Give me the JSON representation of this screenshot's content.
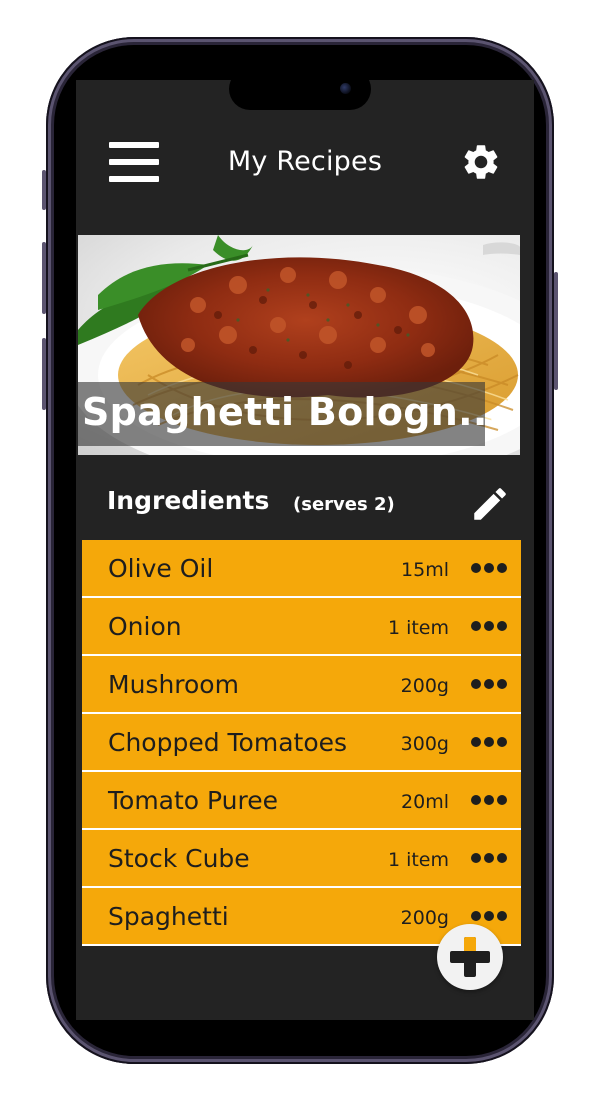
{
  "header": {
    "title": "My Recipes",
    "menu_icon": "hamburger-menu-icon",
    "settings_icon": "gear-icon"
  },
  "recipe": {
    "title": "Spaghetti Bologn..."
  },
  "ingredients": {
    "title": "Ingredients",
    "serves": "(serves 2)",
    "edit_icon": "pencil-icon",
    "items": [
      {
        "name": "Olive Oil",
        "qty": "15ml"
      },
      {
        "name": "Onion",
        "qty": "1 item"
      },
      {
        "name": "Mushroom",
        "qty": "200g"
      },
      {
        "name": "Chopped Tomatoes",
        "qty": "300g"
      },
      {
        "name": "Tomato Puree",
        "qty": "20ml"
      },
      {
        "name": "Stock Cube",
        "qty": "1 item"
      },
      {
        "name": "Spaghetti",
        "qty": "200g"
      }
    ]
  },
  "fab": {
    "icon": "plus-icon"
  },
  "colors": {
    "accent": "#f5a80a",
    "background": "#232323",
    "text_dark": "#1e1e1e",
    "text_light": "#ffffff"
  }
}
